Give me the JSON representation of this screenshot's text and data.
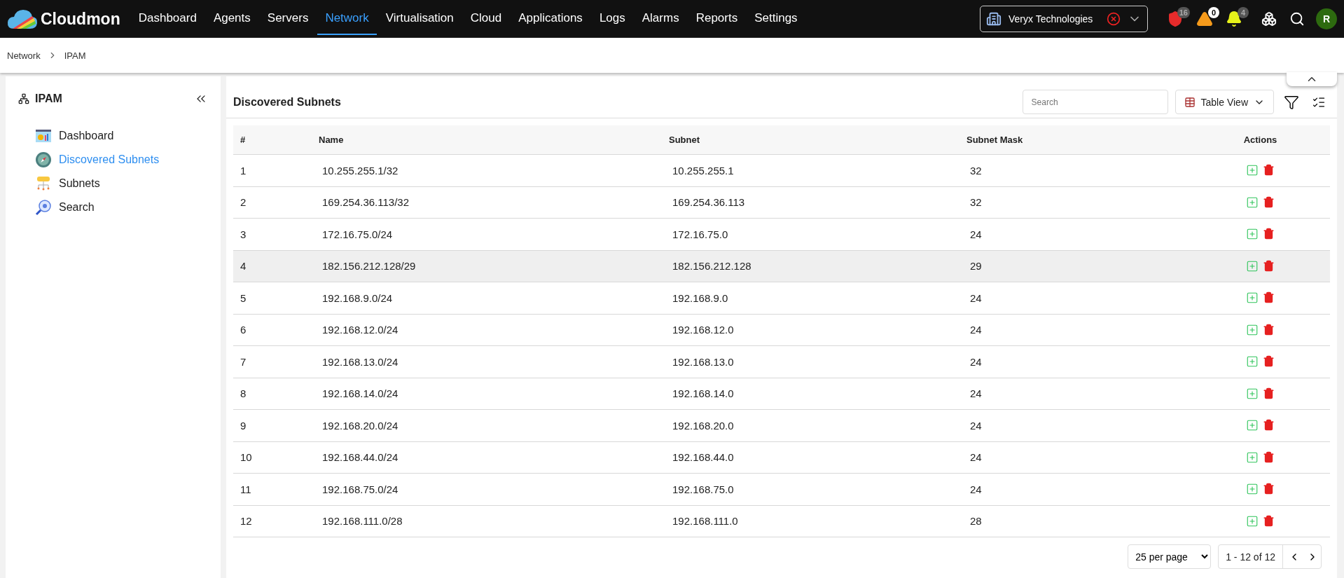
{
  "topbar": {
    "logo": "Cloudmon",
    "nav": [
      {
        "label": "Dashboard",
        "selected": false
      },
      {
        "label": "Agents",
        "selected": false
      },
      {
        "label": "Servers",
        "selected": false
      },
      {
        "label": "Network",
        "selected": true
      },
      {
        "label": "Virtualisation",
        "selected": false
      },
      {
        "label": "Cloud",
        "selected": false
      },
      {
        "label": "Applications",
        "selected": false
      },
      {
        "label": "Logs",
        "selected": false
      },
      {
        "label": "Alarms",
        "selected": false
      },
      {
        "label": "Reports",
        "selected": false
      },
      {
        "label": "Settings",
        "selected": false
      }
    ],
    "tenant": "Veryx Technologies",
    "alerts": [
      {
        "kind": "shield",
        "count": "16"
      },
      {
        "kind": "warning",
        "count": "0"
      },
      {
        "kind": "bell",
        "count": "4"
      }
    ],
    "avatar": "R"
  },
  "breadcrumb": [
    "Network",
    "IPAM"
  ],
  "sidebar": {
    "title": "IPAM",
    "items": [
      {
        "kind": "dashboard",
        "label": "Dashboard",
        "selected": false
      },
      {
        "kind": "compass",
        "label": "Discovered Subnets",
        "selected": true
      },
      {
        "kind": "subnets",
        "label": "Subnets",
        "selected": false
      },
      {
        "kind": "search",
        "label": "Search",
        "selected": false
      }
    ]
  },
  "panel": {
    "title": "Discovered Subnets",
    "search": {
      "placeholder": "Search"
    },
    "view": "Table View"
  },
  "table": {
    "columns": [
      "#",
      "Name",
      "Subnet",
      "Subnet Mask",
      "Actions"
    ],
    "rows": [
      {
        "cells": [
          "1",
          "10.255.255.1/32",
          "10.255.255.1",
          "32"
        ],
        "highlighted": false
      },
      {
        "cells": [
          "2",
          "169.254.36.113/32",
          "169.254.36.113",
          "32"
        ],
        "highlighted": false
      },
      {
        "cells": [
          "3",
          "172.16.75.0/24",
          "172.16.75.0",
          "24"
        ],
        "highlighted": false
      },
      {
        "cells": [
          "4",
          "182.156.212.128/29",
          "182.156.212.128",
          "29"
        ],
        "highlighted": true
      },
      {
        "cells": [
          "5",
          "192.168.9.0/24",
          "192.168.9.0",
          "24"
        ],
        "highlighted": false
      },
      {
        "cells": [
          "6",
          "192.168.12.0/24",
          "192.168.12.0",
          "24"
        ],
        "highlighted": false
      },
      {
        "cells": [
          "7",
          "192.168.13.0/24",
          "192.168.13.0",
          "24"
        ],
        "highlighted": false
      },
      {
        "cells": [
          "8",
          "192.168.14.0/24",
          "192.168.14.0",
          "24"
        ],
        "highlighted": false
      },
      {
        "cells": [
          "9",
          "192.168.20.0/24",
          "192.168.20.0",
          "24"
        ],
        "highlighted": false
      },
      {
        "cells": [
          "10",
          "192.168.44.0/24",
          "192.168.44.0",
          "24"
        ],
        "highlighted": false
      },
      {
        "cells": [
          "11",
          "192.168.75.0/24",
          "192.168.75.0",
          "24"
        ],
        "highlighted": false
      },
      {
        "cells": [
          "12",
          "192.168.111.0/28",
          "192.168.111.0",
          "28"
        ],
        "highlighted": false
      }
    ]
  },
  "pagination": {
    "per_page": "25 per page",
    "range": "1 - 12 of 12"
  }
}
